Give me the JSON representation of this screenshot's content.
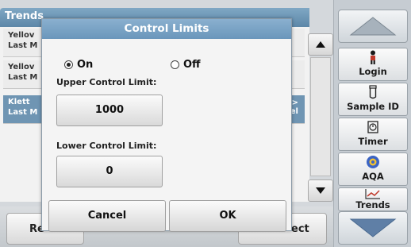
{
  "screen": {
    "title": "Trends"
  },
  "list_rows": [
    {
      "line1": "Yellov",
      "line2": "Last M"
    },
    {
      "line1": "Yellov",
      "line2": "Last M"
    },
    {
      "line1": "Klett",
      "line2": "Last M",
      "right1": "e>",
      "right2": "nel",
      "selected": true
    }
  ],
  "bottom_bar": {
    "left_label": "Re",
    "right_label": "ect"
  },
  "sidebar": {
    "login_label": "Login",
    "sample_id_label": "Sample ID",
    "timer_label": "Timer",
    "aqa_label": "AQA",
    "trends_label": "Trends"
  },
  "dialog": {
    "title": "Control Limits",
    "radio_on_label": "On",
    "radio_off_label": "Off",
    "selected": "On",
    "upper_label": "Upper Control Limit:",
    "upper_value": "1000",
    "lower_label": "Lower Control Limit:",
    "lower_value": "0",
    "cancel_label": "Cancel",
    "ok_label": "OK"
  },
  "colors": {
    "title_bar": "#6a96bb",
    "selected_row": "#6f95b3",
    "sidebar_bg": "#c6ccd2"
  }
}
